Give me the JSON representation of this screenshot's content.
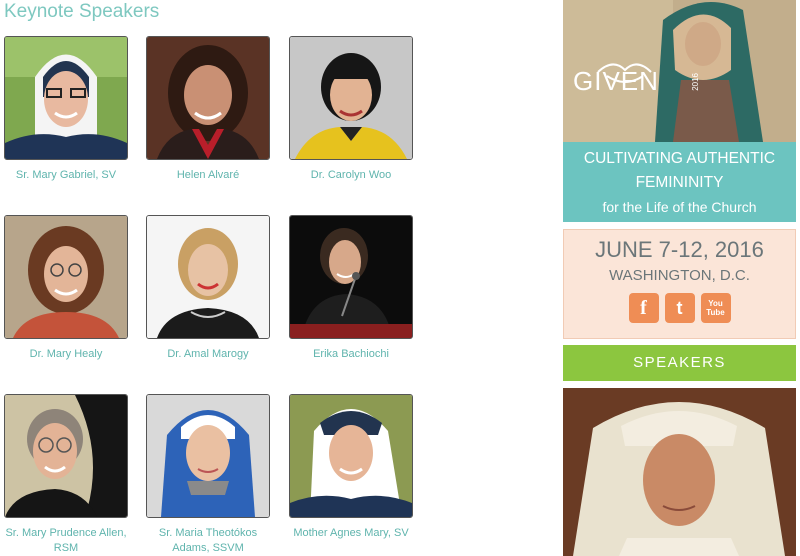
{
  "main": {
    "title": "Keynote Speakers",
    "speakers": [
      {
        "name": "Sr. Mary Gabriel, SV"
      },
      {
        "name": "Helen Alvaré"
      },
      {
        "name": "Dr. Carolyn Woo"
      },
      {
        "name": "Dr. Mary Healy"
      },
      {
        "name": "Dr. Amal Marogy"
      },
      {
        "name": "Erika Bachiochi"
      },
      {
        "name": "Sr. Mary Prudence Allen, RSM"
      },
      {
        "name": "Sr. Maria Theotókos Adams, SSVM"
      },
      {
        "name": "Mother Agnes Mary, SV"
      }
    ]
  },
  "sidebar": {
    "logo": "GIVEN",
    "logo_year": "2016",
    "tagline_line1": "CULTIVATING AUTHENTIC",
    "tagline_line2": "FEMININITY",
    "tagline_line3": "for the Life of the Church",
    "date": "JUNE 7-12, 2016",
    "location": "WASHINGTON, D.C.",
    "social": [
      {
        "icon": "facebook-icon",
        "glyph": "f"
      },
      {
        "icon": "twitter-icon",
        "glyph": "t"
      },
      {
        "icon": "youtube-icon",
        "glyph": "You Tube"
      }
    ],
    "speakers_button": "SPEAKERS"
  },
  "colors": {
    "title": "#7ec8c0",
    "name_link": "#5fb4ad",
    "teal": "#6cc4c0",
    "peach": "#fbe5d8",
    "orange": "#ef8d55",
    "green": "#8cc63f"
  }
}
